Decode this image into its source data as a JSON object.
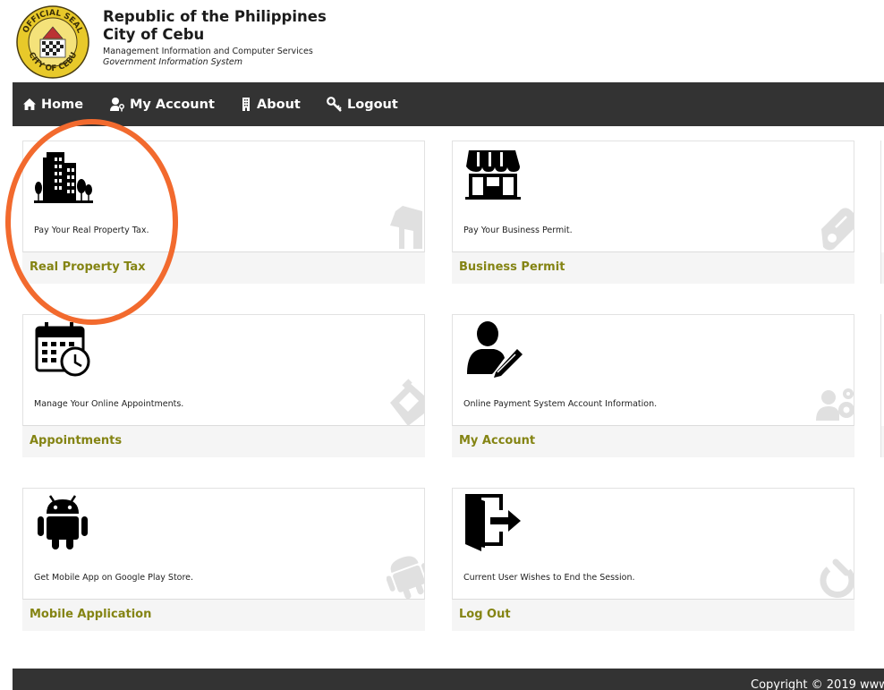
{
  "header": {
    "title_line1": "Republic of the Philippines",
    "title_line2": "City of Cebu",
    "subtitle_line1": "Management Information and Computer Services",
    "subtitle_line2": "Government Information System",
    "seal_text_top": "OFFICIAL SEAL",
    "seal_text_bottom": "CITY OF CEBU"
  },
  "nav": {
    "items": [
      {
        "label": "Home",
        "icon": "home-icon"
      },
      {
        "label": "My Account",
        "icon": "user-key-icon"
      },
      {
        "label": "About",
        "icon": "building-icon"
      },
      {
        "label": "Logout",
        "icon": "key-icon"
      }
    ]
  },
  "cards": [
    {
      "description": "Pay Your Real Property Tax.",
      "label": "Real Property Tax",
      "icon": "buildings-icon",
      "bg_icon": "house-icon"
    },
    {
      "description": "Pay Your Business Permit.",
      "label": "Business Permit",
      "icon": "store-icon",
      "bg_icon": "certificate-icon"
    },
    {
      "description": "Manage Your Online Appointments.",
      "label": "Appointments",
      "icon": "calendar-clock-icon",
      "bg_icon": "calendar-icon"
    },
    {
      "description": "Online Payment System Account Information.",
      "label": "My Account",
      "icon": "user-edit-icon",
      "bg_icon": "user-gear-icon"
    },
    {
      "description": "Get Mobile App on Google Play Store.",
      "label": "Mobile Application",
      "icon": "android-icon",
      "bg_icon": "android-icon"
    },
    {
      "description": "Current User Wishes to End the Session.",
      "label": "Log Out",
      "icon": "exit-door-icon",
      "bg_icon": "power-icon"
    }
  ],
  "footer": {
    "copyright": "Copyright © 2019 www"
  },
  "colors": {
    "navbar_bg": "#333333",
    "card_label": "#848413",
    "annotation": "#f26a2e"
  }
}
